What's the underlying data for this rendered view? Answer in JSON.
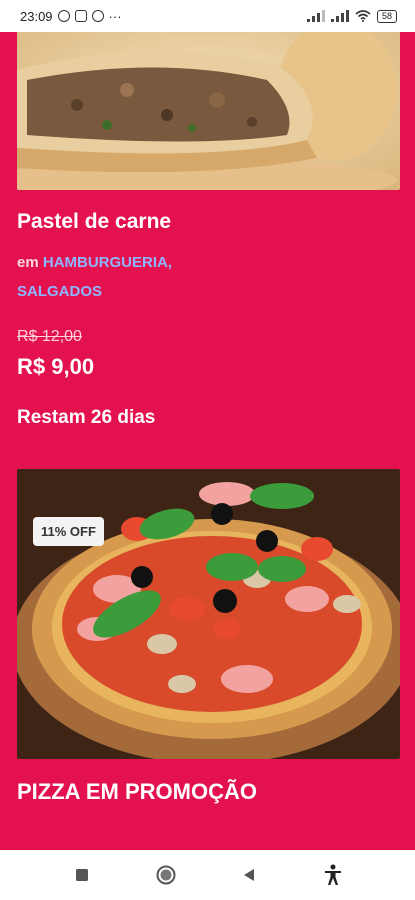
{
  "status_bar": {
    "time": "23:09",
    "battery": "58",
    "icons": [
      "whatsapp-icon",
      "instagram-icon",
      "whatsapp-icon",
      "more-icon",
      "signal-icon",
      "signal-icon",
      "wifi-icon",
      "battery-icon"
    ]
  },
  "offer1": {
    "title": "Pastel de carne",
    "category_prefix": "em",
    "category1": "HAMBURGUERIA,",
    "category2": "SALGADOS",
    "old_price": "R$ 12,00",
    "new_price": "R$ 9,00",
    "remaining": "Restam 26 dias",
    "image": "pastel-photo"
  },
  "offer2": {
    "badge": "11% OFF",
    "title": "PIZZA EM PROMOÇÃO",
    "image": "pizza-photo"
  },
  "nav_bar": {
    "buttons": [
      "recents-icon",
      "home-icon",
      "back-icon",
      "accessibility-icon"
    ]
  },
  "colors": {
    "background": "#e3124f",
    "link": "#8fb5ff"
  }
}
